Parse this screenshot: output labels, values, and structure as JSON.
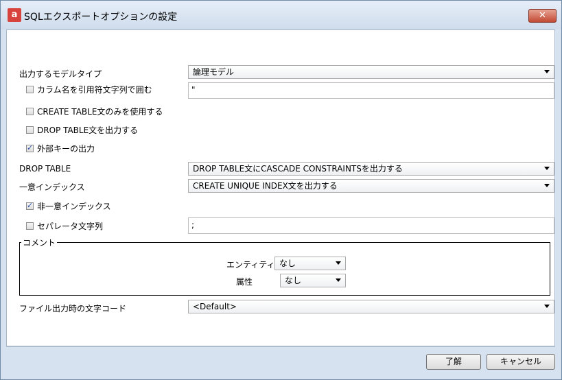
{
  "window": {
    "title": "SQLエクスポートオプションの設定",
    "app_icon": "a",
    "close_glyph": "✕"
  },
  "form": {
    "model_type": {
      "label": "出力するモデルタイプ",
      "value": "論理モデル"
    },
    "quote_columns": {
      "label": "カラム名を引用符文字列で囲む",
      "checked": false,
      "value": "\""
    },
    "create_table_only": {
      "label": "CREATE TABLE文のみを使用する",
      "checked": false
    },
    "drop_table_output": {
      "label": "DROP TABLE文を出力する",
      "checked": false
    },
    "foreign_keys": {
      "label": "外部キーの出力",
      "checked": true
    },
    "drop_table": {
      "label": "DROP TABLE",
      "value": "DROP TABLE文にCASCADE CONSTRAINTSを出力する"
    },
    "unique_index": {
      "label": "一意インデックス",
      "value": "CREATE UNIQUE INDEX文を出力する"
    },
    "non_unique_index": {
      "label": "非一意インデックス",
      "checked": true
    },
    "separator": {
      "label": "セパレータ文字列",
      "checked": false,
      "value": ";"
    },
    "comment": {
      "legend": "コメント",
      "entity": {
        "label": "エンティティ",
        "value": "なし"
      },
      "attribute": {
        "label": "属性",
        "value": "なし"
      }
    },
    "encoding": {
      "label": "ファイル出力時の文字コード",
      "value": "<Default>"
    }
  },
  "buttons": {
    "ok": "了解",
    "cancel": "キャンセル"
  }
}
